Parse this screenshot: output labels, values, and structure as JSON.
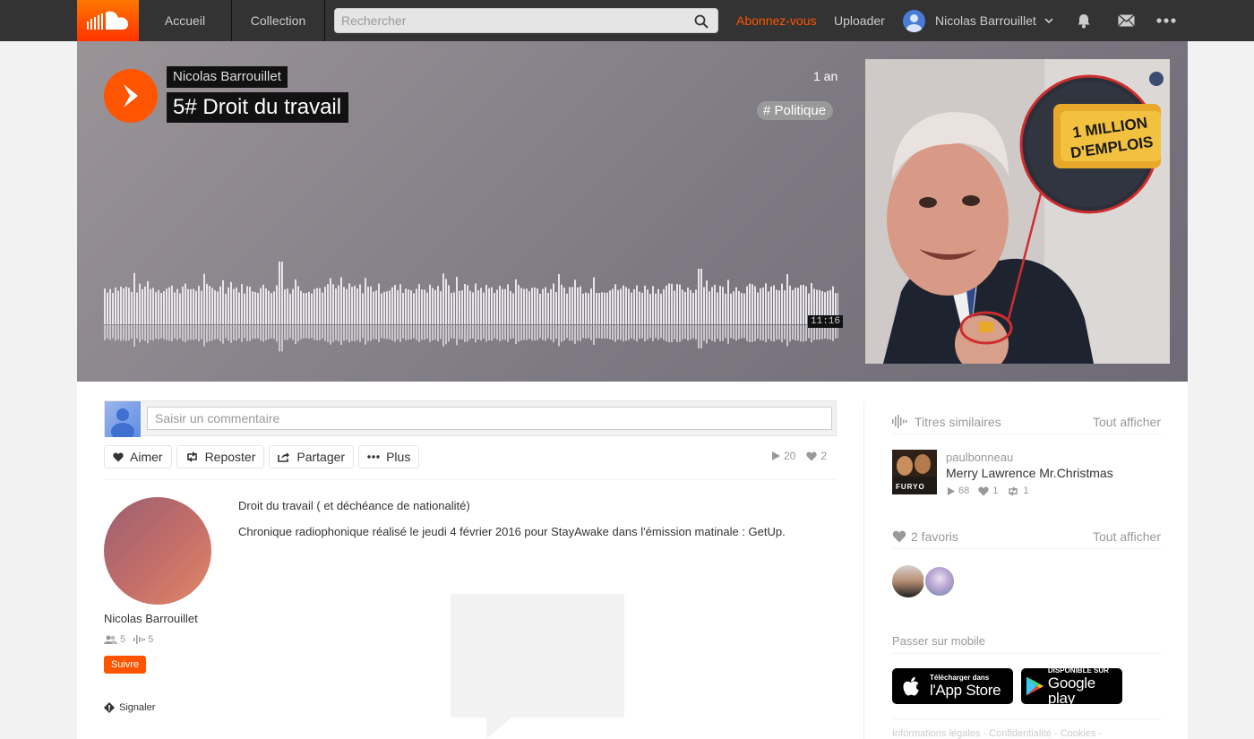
{
  "nav": {
    "home": "Accueil",
    "collection": "Collection",
    "search_placeholder": "Rechercher",
    "go": "Abonnez-vous",
    "upload": "Uploader",
    "username": "Nicolas Barrouillet"
  },
  "track": {
    "artist": "Nicolas Barrouillet",
    "title": "5# Droit du travail",
    "posted": "1 an",
    "tag": "# Politique",
    "duration": "11:16",
    "plays": "20",
    "likes": "2"
  },
  "actions": {
    "comment_placeholder": "Saisir un commentaire",
    "like": "Aimer",
    "repost": "Reposter",
    "share": "Partager",
    "more": "Plus"
  },
  "uploader": {
    "name": "Nicolas Barrouillet",
    "followers": "5",
    "tracks": "5",
    "follow": "Suivre",
    "report": "Signaler"
  },
  "description": {
    "title": "Droit du travail ( et déchéance de nationalité)",
    "body": "Chronique radiophonique réalisé le jeudi 4 février 2016 pour StayAwake dans l'émission matinale : GetUp."
  },
  "sidebar": {
    "related_heading": "Titres similaires",
    "view_all": "Tout afficher",
    "related": {
      "user": "paulbonneau",
      "title": "Merry Lawrence Mr.Christmas",
      "plays": "68",
      "likes": "1",
      "reposts": "1",
      "cover_text": "FURYO"
    },
    "likes_heading": "2 favoris",
    "mobile_heading": "Passer sur mobile",
    "appstore_small": "Télécharger dans",
    "appstore_big": "l'App Store",
    "playstore_small": "DISPONIBLE SUR",
    "playstore_big": "Google play",
    "footer": "Informations légales - Confidentialité - Cookies -"
  },
  "artwork": {
    "sign_line1": "1 MILLION",
    "sign_line2": "D'EMPLOIS"
  },
  "colors": {
    "accent": "#ff5500",
    "topbar": "#333333"
  }
}
